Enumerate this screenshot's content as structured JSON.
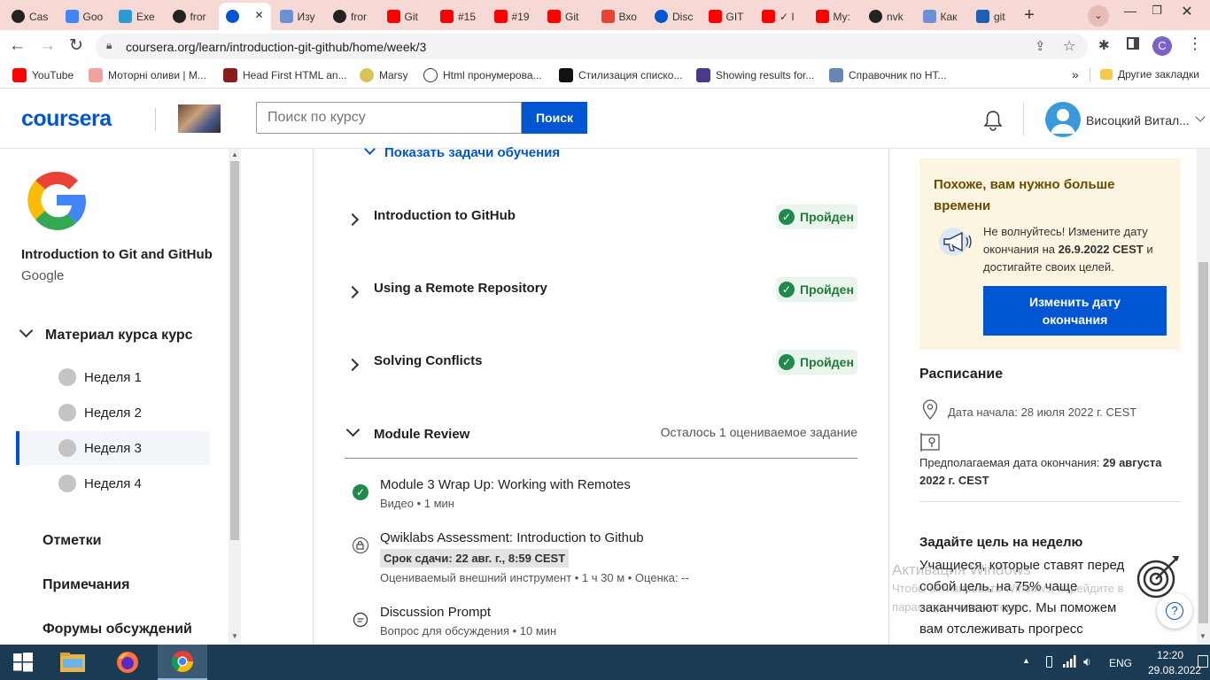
{
  "browser": {
    "tabs": [
      {
        "label": "Cas",
        "icon": "github-icon"
      },
      {
        "label": "Goo",
        "icon": "google-icon"
      },
      {
        "label": "Exe",
        "icon": "fr-icon"
      },
      {
        "label": "fror",
        "icon": "github-icon"
      },
      {
        "label": "",
        "icon": "coursera-icon",
        "active": true
      },
      {
        "label": "Изу",
        "icon": "app-icon"
      },
      {
        "label": "fror",
        "icon": "github-icon"
      },
      {
        "label": "Git",
        "icon": "youtube-icon"
      },
      {
        "label": "#15",
        "icon": "youtube-icon"
      },
      {
        "label": "#19",
        "icon": "youtube-icon"
      },
      {
        "label": "Git",
        "icon": "youtube-icon"
      },
      {
        "label": "Вхо",
        "icon": "gmail-icon"
      },
      {
        "label": "Disc",
        "icon": "coursera-icon"
      },
      {
        "label": "GIT",
        "icon": "youtube-icon"
      },
      {
        "label": "✓ I",
        "icon": "youtube-icon"
      },
      {
        "label": "Му:",
        "icon": "youtube-icon"
      },
      {
        "label": "nvk",
        "icon": "github-icon"
      },
      {
        "label": "Как",
        "icon": "app-icon"
      },
      {
        "label": "git",
        "icon": "doc-icon"
      }
    ],
    "new_tab": "+",
    "url": "coursera.org/learn/introduction-git-github/home/week/3",
    "profile_letter": "C",
    "bookmarks": [
      {
        "label": "YouTube",
        "icon": "youtube-icon"
      },
      {
        "label": "Моторні оливи | М...",
        "icon": "ft-icon"
      },
      {
        "label": "Head First HTML an...",
        "icon": "w-icon"
      },
      {
        "label": "Marsy",
        "icon": "marsy-icon"
      },
      {
        "label": "Html пронумерова...",
        "icon": "s-icon"
      },
      {
        "label": "Стилизация списко...",
        "icon": "m-icon"
      },
      {
        "label": "Showing results for...",
        "icon": "v-icon"
      },
      {
        "label": "Справочник по HT...",
        "icon": "gear-icon"
      }
    ],
    "bookmarks_more": "»",
    "other_bookmarks": "Другие закладки"
  },
  "header": {
    "logo": "coursera",
    "search_placeholder": "Поиск по курсу",
    "search_button": "Поиск",
    "user_name": "Висоцкий Витал..."
  },
  "sidebar": {
    "course_title": "Introduction to Git and GitHub",
    "provider": "Google",
    "material_label": "Материал курса курс",
    "weeks": [
      {
        "label": "Неделя 1",
        "active": false
      },
      {
        "label": "Неделя 2",
        "active": false
      },
      {
        "label": "Неделя 3",
        "active": true
      },
      {
        "label": "Неделя 4",
        "active": false
      }
    ],
    "links": [
      "Отметки",
      "Примечания",
      "Форумы обсуждений"
    ]
  },
  "main": {
    "show_objectives": "Показать задачи обучения",
    "lessons": [
      {
        "title": "Introduction to GitHub",
        "status": "Пройден"
      },
      {
        "title": "Using a Remote Repository",
        "status": "Пройден"
      },
      {
        "title": "Solving Conflicts",
        "status": "Пройден"
      }
    ],
    "review": {
      "title": "Module Review",
      "remaining": "Осталось 1 оцениваемое задание",
      "items": [
        {
          "title": "Module 3 Wrap Up: Working with Remotes",
          "meta": "Видео • 1 мин",
          "icon": "check-circle-icon"
        },
        {
          "title": "Qwiklabs Assessment: Introduction to Github",
          "deadline": "Срок сдачи: 22 авг. г., 8:59 CEST",
          "meta": "Оцениваемый внешний инструмент • 1 ч 30 м • Оценка: --",
          "icon": "lock-icon"
        },
        {
          "title": "Discussion Prompt",
          "meta": "Вопрос для обсуждения • 10 мин",
          "icon": "chat-bubble-icon"
        }
      ]
    }
  },
  "right": {
    "time_title": "Похоже, вам нужно больше времени",
    "time_text_1": "Не волнуйтесь! Измените дату окончания на ",
    "time_date": "26.9.2022 CEST",
    "time_text_2": " и достигайте своих целей.",
    "change_button": "Изменить дату окончания",
    "schedule_title": "Расписание",
    "start_date": "Дата начала: 28 июля 2022 г. CEST",
    "end_label": "Предполагаемая дата окончания: ",
    "end_date": "29 августа 2022 г. CEST",
    "goal_title": "Задайте цель на неделю",
    "goal_text": "Учащиеся, которые ставят перед собой цель, на 75% чаще заканчивают курс. Мы поможем вам отслеживать прогресс",
    "help_icon": "?"
  },
  "watermark": {
    "line1": "Активация Windows",
    "line2": "Чтобы активировать Windows, перейдите в",
    "line3": "параметры компьютера."
  },
  "taskbar": {
    "lang": "ENG",
    "time": "12:20",
    "date": "29.08.2022"
  },
  "colors": {
    "brand": "#0056d2",
    "success": "#1f8a4c",
    "tabbar": "#f6d8d4",
    "notice_bg": "#fcf5e2",
    "taskbar": "#1b3a53"
  }
}
